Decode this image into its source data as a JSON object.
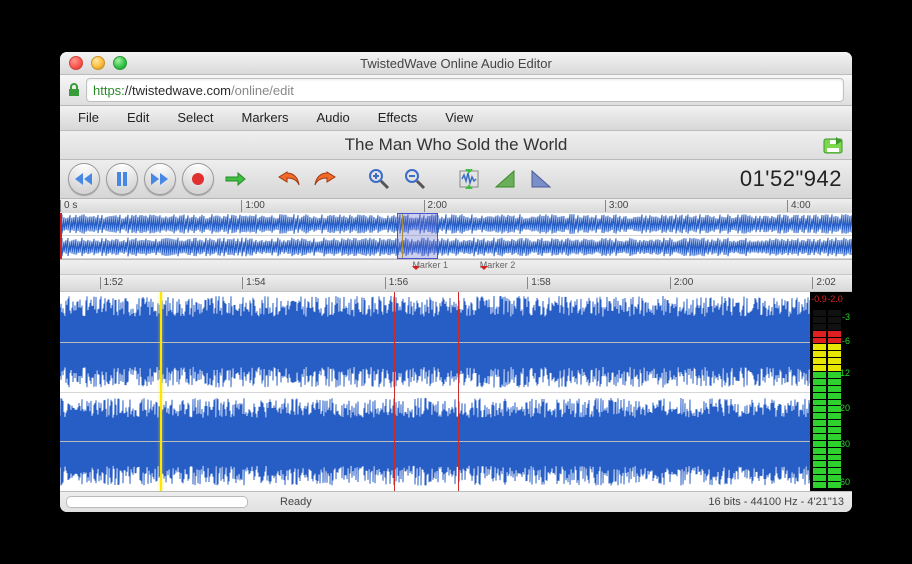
{
  "window_title": "TwistedWave Online Audio Editor",
  "url": {
    "proto": "https:",
    "host": "//twistedwave.com",
    "path": "/online/edit"
  },
  "menus": [
    "File",
    "Edit",
    "Select",
    "Markers",
    "Audio",
    "Effects",
    "View"
  ],
  "document_title": "The Man Who Sold the World",
  "time_display": "01'52\"942",
  "timeline_overview": {
    "labels": [
      "0 s",
      "1:00",
      "2:00",
      "3:00",
      "4:00"
    ],
    "positions_pct": [
      0,
      22.9,
      45.9,
      68.8,
      91.8
    ],
    "view_window_pct": [
      42.5,
      47.5
    ],
    "red_marker_pct": 0,
    "playhead_pct": 43.2
  },
  "markers": [
    {
      "label": "Marker 1",
      "pos_pct": 44.5
    },
    {
      "label": "Marker 2",
      "pos_pct": 53
    }
  ],
  "detail_ruler": {
    "labels": [
      "1:52",
      "1:54",
      "1:56",
      "1:58",
      "2:00",
      "2:02"
    ],
    "positions_pct": [
      5,
      23,
      41,
      59,
      77,
      95
    ]
  },
  "detail": {
    "playhead_pct": 13.3,
    "marker_lines_pct": [
      44.5,
      53
    ]
  },
  "meter": {
    "peaks": [
      "-0.9",
      "-2.0"
    ],
    "scale_labels": [
      "-3",
      "-6",
      "-12",
      "-20",
      "-30",
      "-60"
    ],
    "scale_positions_pct": [
      10,
      22,
      38,
      56,
      74,
      96
    ],
    "bar_levels_pct": [
      88,
      86
    ]
  },
  "status": {
    "ready": "Ready",
    "info": "16 bits - 44100 Hz - 4'21\"13"
  }
}
